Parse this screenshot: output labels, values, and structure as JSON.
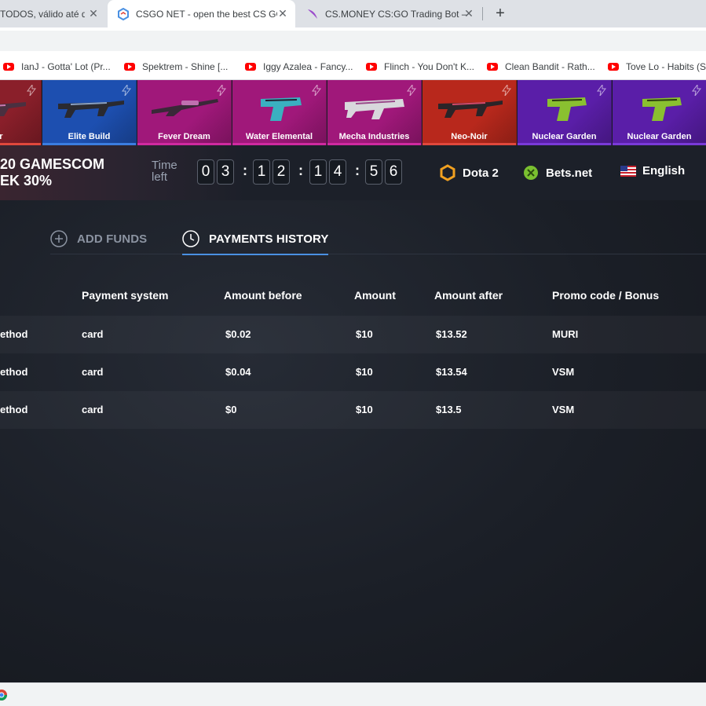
{
  "browser": {
    "tabs": [
      {
        "label": "TODOS, válido até d",
        "active": false
      },
      {
        "label": "CSGO NET - open the best CS GO",
        "active": true
      },
      {
        "label": "CS.MONEY CS:GO Trading Bot —",
        "active": false
      }
    ],
    "new_tab_label": "+",
    "close_glyph": "✕",
    "bookmarks": [
      "IanJ - Gotta' Lot (Pr...",
      "Spektrem - Shine [...",
      "Iggy Azalea - Fancy...",
      "Flinch - You Don't K...",
      "Clean Bandit - Rath...",
      "Tove Lo - Habits (St"
    ]
  },
  "skins": [
    {
      "name": "Noir",
      "bg": "#8a1f2a",
      "underline": "#e0483c"
    },
    {
      "name": "Elite Build",
      "bg": "#1d4fb0",
      "underline": "#3b7de0"
    },
    {
      "name": "Fever Dream",
      "bg": "#a0187a",
      "underline": "#d02aa0"
    },
    {
      "name": "Water Elemental",
      "bg": "#a0187a",
      "underline": "#d02aa0"
    },
    {
      "name": "Mecha Industries",
      "bg": "#a0187a",
      "underline": "#d02aa0"
    },
    {
      "name": "Neo-Noir",
      "bg": "#b8281c",
      "underline": "#e0483c"
    },
    {
      "name": "Nuclear Garden",
      "bg": "#5a1ea8",
      "underline": "#7a3ad8"
    },
    {
      "name": "Nuclear Garden",
      "bg": "#5a1ea8",
      "underline": "#7a3ad8"
    }
  ],
  "promo": {
    "line1": "20 GAMESCOM",
    "line2": "EK 30%",
    "time_left_line1": "Time",
    "time_left_line2": "left",
    "digits": [
      "0",
      "3",
      "1",
      "2",
      "1",
      "4",
      "5",
      "6"
    ],
    "colon": ":"
  },
  "toplinks": {
    "dota": "Dota 2",
    "bets": "Bets.net",
    "language": "English"
  },
  "page_tabs": {
    "add_funds": "ADD FUNDS",
    "payments_history": "PAYMENTS HISTORY"
  },
  "table": {
    "headers": [
      "Payment system",
      "Amount before",
      "Amount",
      "Amount after",
      "Promo code / Bonus"
    ],
    "rows": [
      [
        "ethod",
        "card",
        "$0.02",
        "$10",
        "$13.52",
        "MURI"
      ],
      [
        "ethod",
        "card",
        "$0.04",
        "$10",
        "$13.54",
        "VSM"
      ],
      [
        "ethod",
        "card",
        "$0",
        "$10",
        "$13.5",
        "VSM"
      ]
    ]
  },
  "colors": {
    "accent_blue": "#4a90e2",
    "page_bg": "#1b1f27"
  }
}
